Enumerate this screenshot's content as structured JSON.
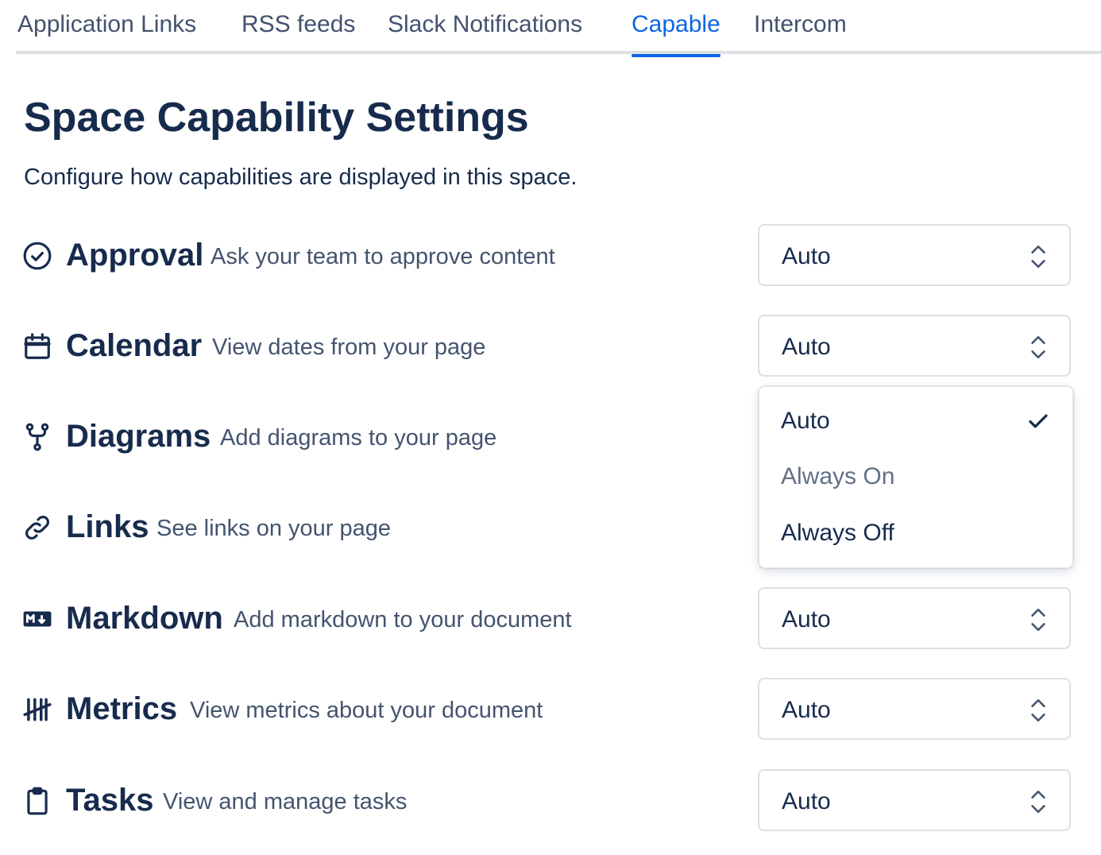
{
  "tabs": [
    {
      "label": "Application Links"
    },
    {
      "label": "RSS feeds"
    },
    {
      "label": "Slack Notifications"
    },
    {
      "label": "Capable"
    },
    {
      "label": "Intercom"
    }
  ],
  "header": {
    "title": "Space Capability Settings",
    "description": "Configure how capabilities are displayed in this space."
  },
  "capabilities": [
    {
      "name": "Approval",
      "description": "Ask your team to approve content",
      "icon": "check-circle-icon",
      "value": "Auto"
    },
    {
      "name": "Calendar",
      "description": "View dates from your page",
      "icon": "calendar-icon",
      "value": "Auto"
    },
    {
      "name": "Diagrams",
      "description": "Add diagrams to your page",
      "icon": "git-fork-icon",
      "value": "Auto"
    },
    {
      "name": "Links",
      "description": "See links on your page",
      "icon": "link-icon",
      "value": "Auto"
    },
    {
      "name": "Markdown",
      "description": "Add markdown to your document",
      "icon": "markdown-icon",
      "value": "Auto"
    },
    {
      "name": "Metrics",
      "description": "View metrics about your document",
      "icon": "tally-icon",
      "value": "Auto"
    },
    {
      "name": "Tasks",
      "description": "View and manage tasks",
      "icon": "clipboard-icon",
      "value": "Auto"
    }
  ],
  "dropdown": {
    "options": [
      {
        "label": "Auto",
        "selected": true
      },
      {
        "label": "Always On",
        "selected": false
      },
      {
        "label": "Always Off",
        "selected": false
      }
    ]
  },
  "colors": {
    "accent": "#0c66e4",
    "text": "#172b4d",
    "subtle_text": "#44546f",
    "border": "#dcdfe4"
  }
}
